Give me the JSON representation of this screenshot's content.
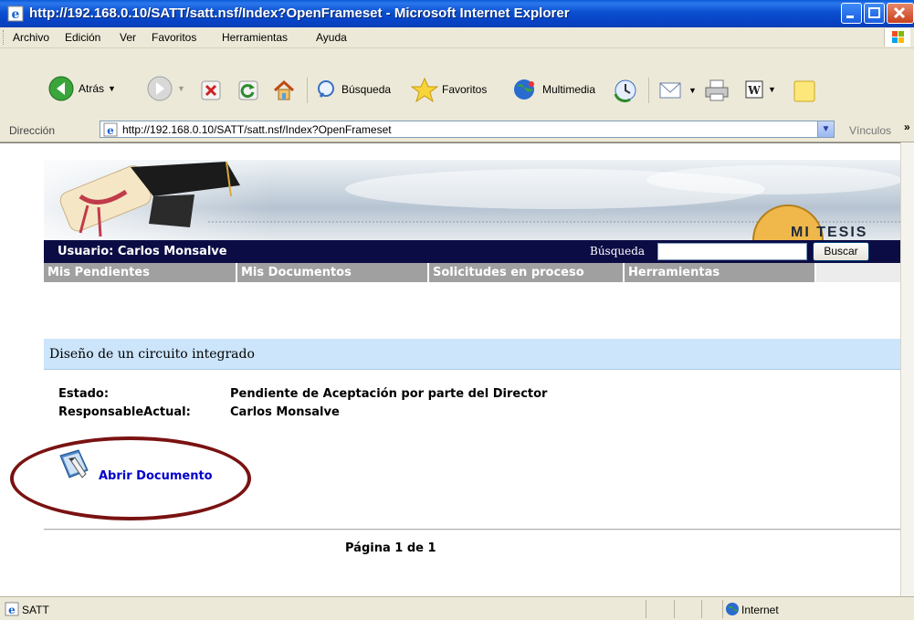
{
  "window": {
    "title": "http://192.168.0.10/SATT/satt.nsf/Index?OpenFrameset - Microsoft Internet Explorer"
  },
  "menu": [
    "Archivo",
    "Edición",
    "Ver",
    "Favoritos",
    "Herramientas",
    "Ayuda"
  ],
  "toolbar": {
    "back": "Atrás",
    "search": "Búsqueda",
    "favorites": "Favoritos",
    "media": "Multimedia"
  },
  "address": {
    "label": "Dirección",
    "url": "http://192.168.0.10/SATT/satt.nsf/Index?OpenFrameset",
    "links": "Vínculos"
  },
  "banner": {
    "logo_text": "MI TESIS"
  },
  "nav": {
    "user": "Usuario: Carlos Monsalve",
    "search_label": "Búsqueda",
    "search_value": "",
    "search_button": "Buscar"
  },
  "tabs": [
    "Mis Pendientes",
    "Mis Documentos",
    "Solicitudes en proceso",
    "Herramientas"
  ],
  "document": {
    "title": "Diseño de un circuito integrado",
    "estado_label": "Estado:",
    "estado_value": "Pendiente de Aceptación por parte del Director",
    "responsable_label": "ResponsableActual:",
    "responsable_value": "Carlos Monsalve",
    "open_link": "Abrir Documento",
    "pagination": "Página 1 de 1"
  },
  "status": {
    "text": "SATT",
    "zone": "Internet"
  }
}
